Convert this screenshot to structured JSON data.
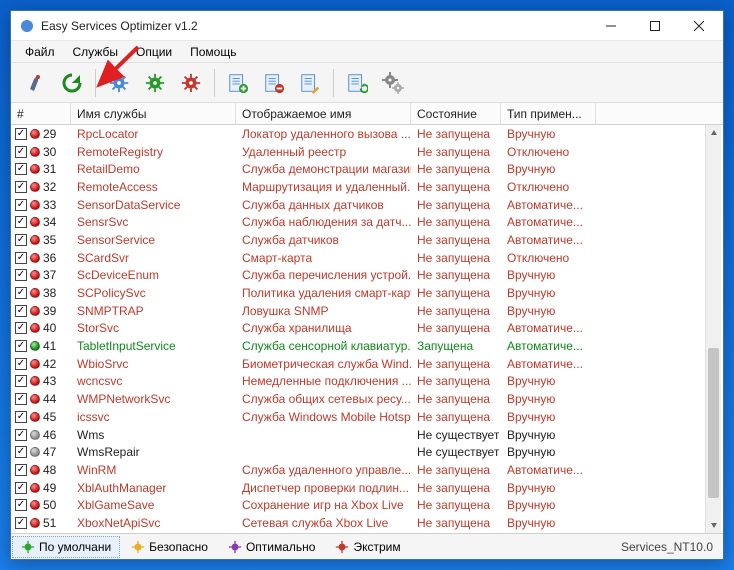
{
  "window": {
    "title": "Easy Services Optimizer v1.2"
  },
  "menu": {
    "file": "Файл",
    "services": "Службы",
    "options": "Опции",
    "help": "Помощь"
  },
  "columns": {
    "num": "#",
    "name": "Имя службы",
    "display": "Отображаемое имя",
    "state": "Состояние",
    "starttype": "Тип примен..."
  },
  "rows": [
    {
      "n": "29",
      "dot": "red",
      "svc": "RpcLocator",
      "disp": "Локатор удаленного вызова ...",
      "st": "Не запущена",
      "tp": "Вручную",
      "cls": "c-red"
    },
    {
      "n": "30",
      "dot": "red",
      "svc": "RemoteRegistry",
      "disp": "Удаленный реестр",
      "st": "Не запущена",
      "tp": "Отключено",
      "cls": "c-red"
    },
    {
      "n": "31",
      "dot": "red",
      "svc": "RetailDemo",
      "disp": "Служба демонстрации магазина",
      "st": "Не запущена",
      "tp": "Вручную",
      "cls": "c-red"
    },
    {
      "n": "32",
      "dot": "red",
      "svc": "RemoteAccess",
      "disp": "Маршрутизация и удаленный...",
      "st": "Не запущена",
      "tp": "Отключено",
      "cls": "c-red"
    },
    {
      "n": "33",
      "dot": "red",
      "svc": "SensorDataService",
      "disp": "Служба данных датчиков",
      "st": "Не запущена",
      "tp": "Автоматиче...",
      "cls": "c-red"
    },
    {
      "n": "34",
      "dot": "red",
      "svc": "SensrSvc",
      "disp": "Служба наблюдения за датч...",
      "st": "Не запущена",
      "tp": "Автоматиче...",
      "cls": "c-red"
    },
    {
      "n": "35",
      "dot": "red",
      "svc": "SensorService",
      "disp": "Служба датчиков",
      "st": "Не запущена",
      "tp": "Автоматиче...",
      "cls": "c-red"
    },
    {
      "n": "36",
      "dot": "red",
      "svc": "SCardSvr",
      "disp": "Смарт-карта",
      "st": "Не запущена",
      "tp": "Отключено",
      "cls": "c-red"
    },
    {
      "n": "37",
      "dot": "red",
      "svc": "ScDeviceEnum",
      "disp": "Служба перечисления устрой...",
      "st": "Не запущена",
      "tp": "Вручную",
      "cls": "c-red"
    },
    {
      "n": "38",
      "dot": "red",
      "svc": "SCPolicySvc",
      "disp": "Политика удаления смарт-карт",
      "st": "Не запущена",
      "tp": "Вручную",
      "cls": "c-red"
    },
    {
      "n": "39",
      "dot": "red",
      "svc": "SNMPTRAP",
      "disp": "Ловушка SNMP",
      "st": "Не запущена",
      "tp": "Вручную",
      "cls": "c-red"
    },
    {
      "n": "40",
      "dot": "red",
      "svc": "StorSvc",
      "disp": "Служба хранилища",
      "st": "Не запущена",
      "tp": "Автоматиче...",
      "cls": "c-red"
    },
    {
      "n": "41",
      "dot": "green",
      "svc": "TabletInputService",
      "disp": "Служба сенсорной клавиатур...",
      "st": "Запущена",
      "tp": "Автоматиче...",
      "cls": "c-green"
    },
    {
      "n": "42",
      "dot": "red",
      "svc": "WbioSrvc",
      "disp": "Биометрическая служба Wind...",
      "st": "Не запущена",
      "tp": "Автоматиче...",
      "cls": "c-red"
    },
    {
      "n": "43",
      "dot": "red",
      "svc": "wcncsvc",
      "disp": "Немедленные подключения ...",
      "st": "Не запущена",
      "tp": "Вручную",
      "cls": "c-red"
    },
    {
      "n": "44",
      "dot": "red",
      "svc": "WMPNetworkSvc",
      "disp": "Служба общих сетевых ресу...",
      "st": "Не запущена",
      "tp": "Вручную",
      "cls": "c-red"
    },
    {
      "n": "45",
      "dot": "red",
      "svc": "icssvc",
      "disp": "Служба Windows Mobile Hotspot",
      "st": "Не запущена",
      "tp": "Вручную",
      "cls": "c-red"
    },
    {
      "n": "46",
      "dot": "gray",
      "svc": "Wms",
      "disp": "",
      "st": "Не существует",
      "tp": "Вручную",
      "cls": "c-black"
    },
    {
      "n": "47",
      "dot": "gray",
      "svc": "WmsRepair",
      "disp": "",
      "st": "Не существует",
      "tp": "Вручную",
      "cls": "c-black"
    },
    {
      "n": "48",
      "dot": "red",
      "svc": "WinRM",
      "disp": "Служба удаленного управле...",
      "st": "Не запущена",
      "tp": "Автоматиче...",
      "cls": "c-red"
    },
    {
      "n": "49",
      "dot": "red",
      "svc": "XblAuthManager",
      "disp": "Диспетчер проверки подлин...",
      "st": "Не запущена",
      "tp": "Вручную",
      "cls": "c-red"
    },
    {
      "n": "50",
      "dot": "red",
      "svc": "XblGameSave",
      "disp": "Сохранение игр на Xbox Live",
      "st": "Не запущена",
      "tp": "Вручную",
      "cls": "c-red"
    },
    {
      "n": "51",
      "dot": "red",
      "svc": "XboxNetApiSvc",
      "disp": "Сетевая служба Xbox Live",
      "st": "Не запущена",
      "tp": "Вручную",
      "cls": "c-red"
    }
  ],
  "profiles": {
    "default": "По умолчани",
    "safe": "Безопасно",
    "optimal": "Оптимально",
    "extreme": "Экстрим"
  },
  "status_right": "Services_NT10.0"
}
